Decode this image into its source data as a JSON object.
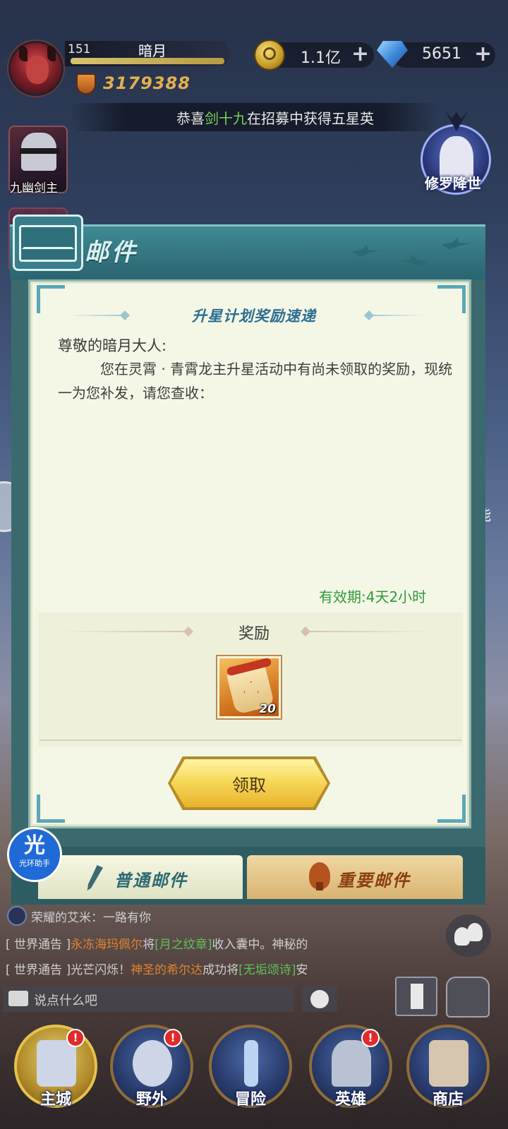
{
  "player": {
    "level": "151",
    "name": "暗月",
    "power": "3179388"
  },
  "resources": {
    "coins": "1.1亿",
    "gems": "5651",
    "plus": "+"
  },
  "ticker": {
    "prefix": "恭喜",
    "highlight": "剑十九",
    "suffix": "在招募中获得五星英"
  },
  "side": {
    "hero_label": "九幽剑主",
    "event_label": "修罗降世",
    "right_cut_label": "能"
  },
  "mail": {
    "header_title": "邮件",
    "subject": "升星计划奖励速递",
    "greeting": "尊敬的暗月大人:",
    "body": "您在灵霄 · 青霄龙主升星活动中有尚未领取的奖励，现统一为您补发，请您查收：",
    "expire": "有效期:4天2小时",
    "reward_label": "奖励",
    "reward_count": "20",
    "claim_label": "领取"
  },
  "tabs": {
    "normal": "普通邮件",
    "important": "重要邮件"
  },
  "helper": {
    "big": "光",
    "small": "光环助手"
  },
  "chat": {
    "line1": {
      "name": "荣耀的艾米",
      "text": "：一路有你"
    },
    "line2": {
      "tag": "[ 世界通告 ]",
      "player": "永冻海玛佩尔",
      "mid": "将",
      "item": "[月之纹章]",
      "text": "收入囊中。神秘的"
    },
    "line3": {
      "tag": "[ 世界通告 ]",
      "pre": "光芒闪烁！",
      "player": "神圣的希尔达",
      "mid": "成功将",
      "item": "[无垢颂诗]",
      "text": "安"
    },
    "placeholder": "说点什么吧"
  },
  "nav": {
    "items": [
      {
        "label": "主城",
        "badge": "!"
      },
      {
        "label": "野外",
        "badge": "!"
      },
      {
        "label": "冒险",
        "badge": ""
      },
      {
        "label": "英雄",
        "badge": "!"
      },
      {
        "label": "商店",
        "badge": ""
      }
    ]
  },
  "colors": {
    "accent_green": "#2f9a3b",
    "subject_blue": "#2b6e93",
    "button_gold": "#f7d95a",
    "chat_orange": "#e0842f",
    "chat_green": "#5ec05a"
  }
}
